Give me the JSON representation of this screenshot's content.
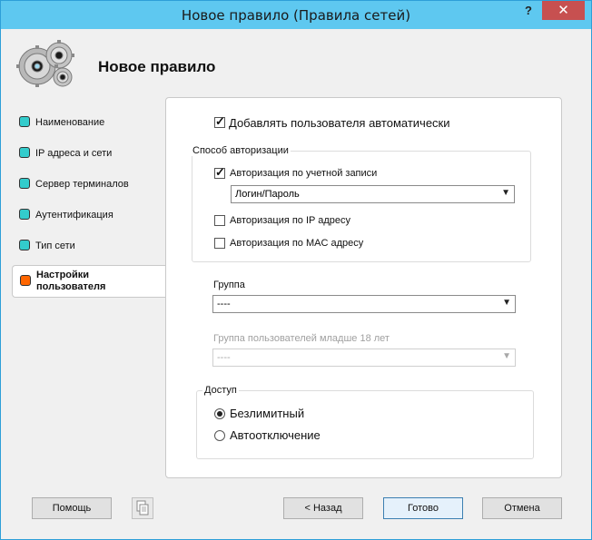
{
  "window": {
    "title": "Новое правило (Правила сетей)",
    "help_glyph": "?",
    "close_glyph": "✕"
  },
  "header": {
    "title": "Новое правило"
  },
  "nav": {
    "items": [
      {
        "label": "Наименование"
      },
      {
        "label": "IP адреса и сети"
      },
      {
        "label": "Сервер терминалов"
      },
      {
        "label": "Аутентификация"
      },
      {
        "label": "Тип сети"
      }
    ],
    "active": {
      "label_line1": "Настройки",
      "label_line2": "пользователя"
    }
  },
  "form": {
    "auto_add_label": "Добавлять пользователя автоматически",
    "auto_add_checked": true,
    "auth_group_title": "Способ авторизации",
    "auth_account_label": "Авторизация по учетной записи",
    "auth_account_checked": true,
    "auth_method_value": "Логин/Пароль",
    "auth_ip_label": "Авторизация по IP адресу",
    "auth_ip_checked": false,
    "auth_mac_label": "Авторизация по MAC адресу",
    "auth_mac_checked": false,
    "group_label": "Группа",
    "group_value": "----",
    "minor_group_label": "Группа пользователей младше 18 лет",
    "minor_group_value": "----",
    "access_group_title": "Доступ",
    "access_unlimited_label": "Безлимитный",
    "access_autooff_label": "Автоотключение",
    "access_selected": "Безлимитный",
    "dropdown_arrow": "▼"
  },
  "buttons": {
    "help": "Помощь",
    "back": "< Назад",
    "done": "Готово",
    "cancel": "Отмена"
  },
  "colors": {
    "titlebar": "#5ec8f0",
    "close": "#c75050",
    "nav_square": "#33cccc",
    "nav_active_square": "#ff6600"
  }
}
